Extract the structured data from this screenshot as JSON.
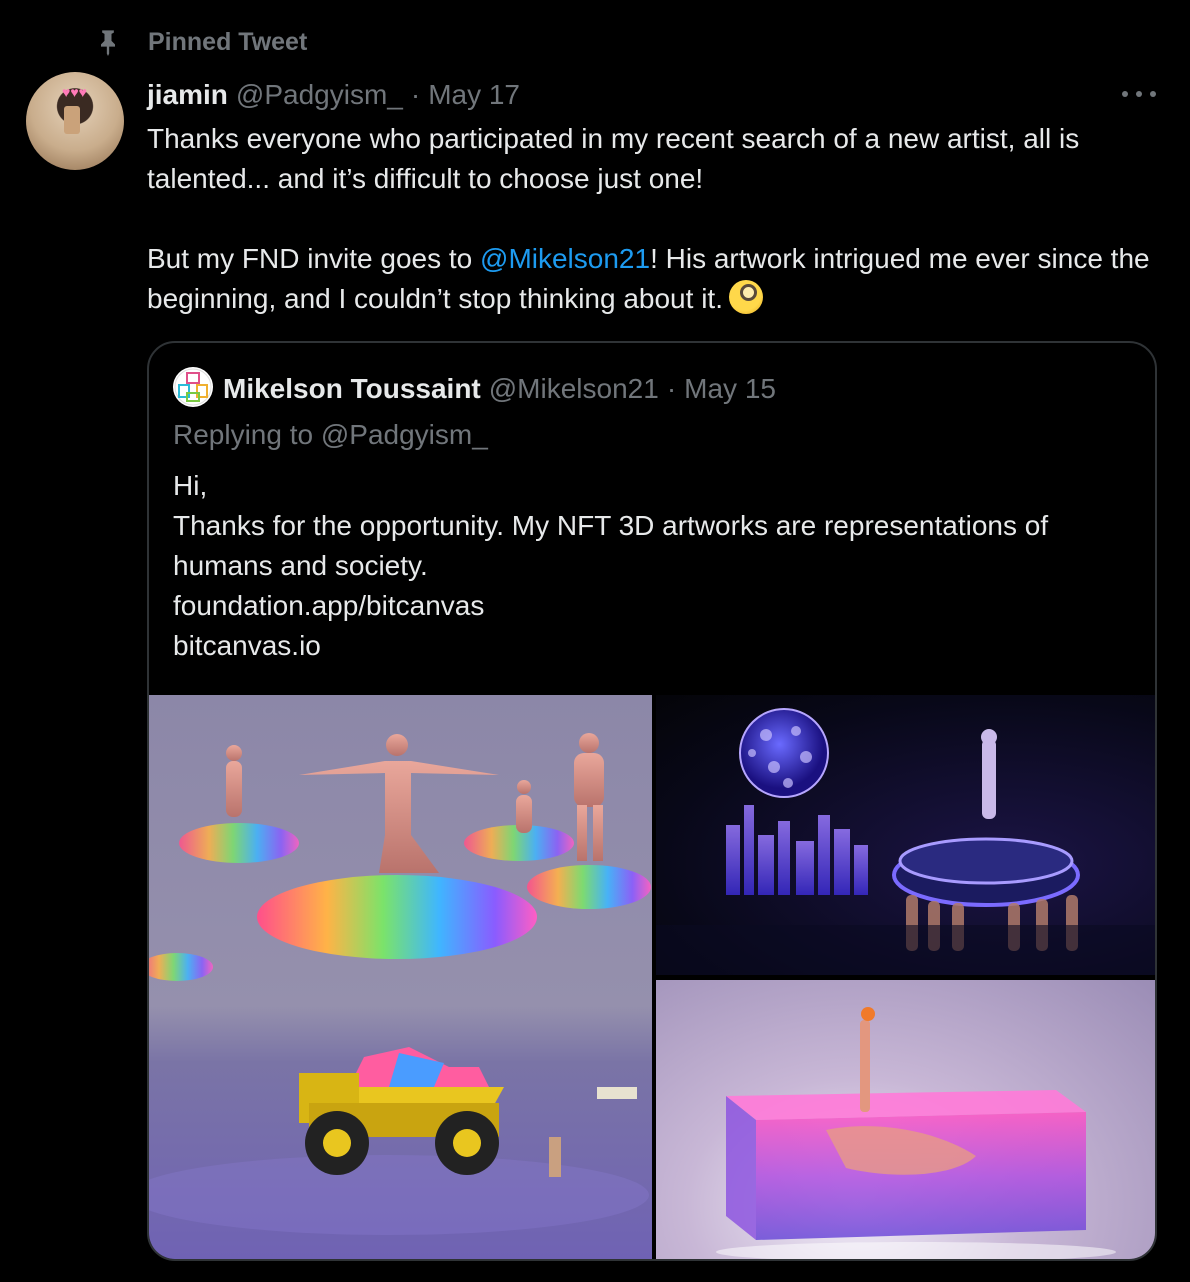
{
  "pinned": {
    "label": "Pinned Tweet",
    "icon": "pin-icon"
  },
  "tweet": {
    "author_name": "jiamin",
    "author_handle": "@Padgyism_",
    "separator": "·",
    "date": "May 17",
    "text_line1": "Thanks everyone who participated in my recent search of a new artist, all is talented... and it’s difficult to choose just one!",
    "text_line2_before": "But my FND invite goes to ",
    "text_line2_mention": "@Mikelson21",
    "text_line2_after": "! His artwork intrigued me ever since the beginning, and I couldn’t stop thinking about it.",
    "emoji": "face-with-monocle-emoji"
  },
  "quote": {
    "author_name": "Mikelson Toussaint",
    "author_handle": "@Mikelson21",
    "separator": "·",
    "date": "May 15",
    "replying_to": "Replying to @Padgyism_",
    "lines": [
      "Hi,",
      "Thanks for the opportunity. My NFT 3D artworks are representations of humans and society.",
      "foundation.app/bitcanvas",
      "bitcanvas.io"
    ],
    "media": [
      "floating-figures-artwork",
      "neon-city-artwork",
      "figure-in-pool-artwork"
    ]
  },
  "colors": {
    "background": "#000000",
    "text": "#e7e9ea",
    "muted": "#71767b",
    "link": "#1d9bf0",
    "border": "#2f3336"
  }
}
